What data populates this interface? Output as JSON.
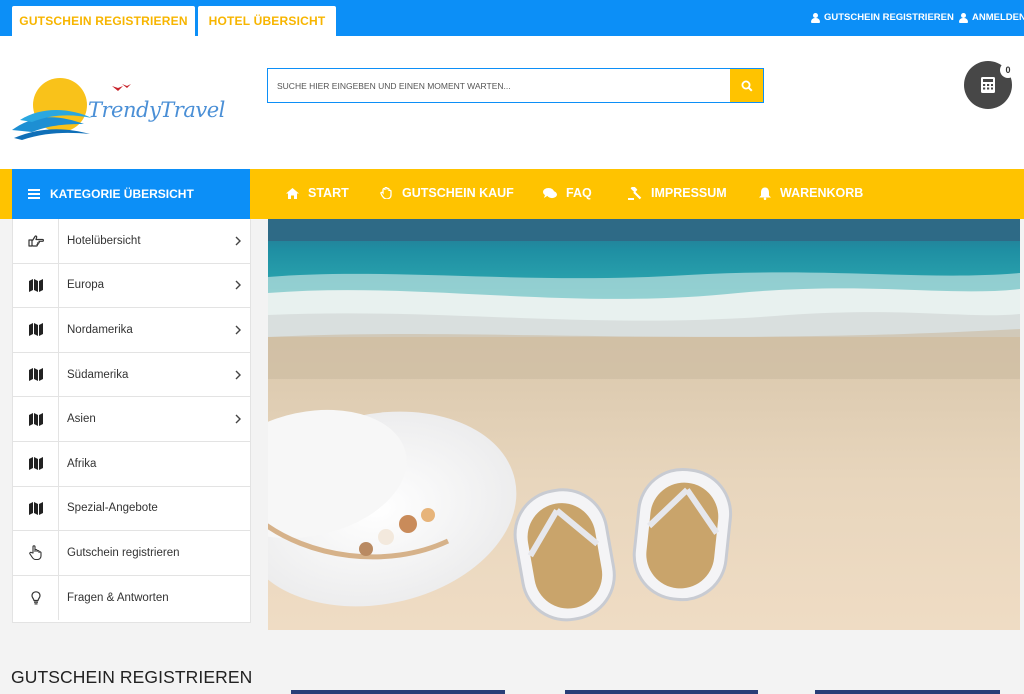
{
  "topbar": {
    "tabs": [
      "GUTSCHEIN REGISTRIEREN",
      "HOTEL ÜBERSICHT"
    ],
    "links": [
      "GUTSCHEIN REGISTRIEREN",
      "ANMELDEN"
    ]
  },
  "header": {
    "logo_text": "TrendyTravel",
    "search_placeholder": "SUCHE HIER EINGEBEN UND EINEN MOMENT WARTEN...",
    "cart_count": "0"
  },
  "nav": {
    "category_label": "KATEGORIE ÜBERSICHT",
    "items": [
      "START",
      "GUTSCHEIN KAUF",
      "FAQ",
      "IMPRESSUM",
      "WARENKORB"
    ]
  },
  "sidebar": {
    "items": [
      {
        "label": "Hotelübersicht",
        "icon": "hand-point-icon",
        "chevron": true
      },
      {
        "label": "Europa",
        "icon": "map-icon",
        "chevron": true
      },
      {
        "label": "Nordamerika",
        "icon": "map-icon",
        "chevron": true
      },
      {
        "label": "Südamerika",
        "icon": "map-icon",
        "chevron": true
      },
      {
        "label": "Asien",
        "icon": "map-icon",
        "chevron": true
      },
      {
        "label": "Afrika",
        "icon": "map-icon",
        "chevron": false
      },
      {
        "label": "Spezial-Angebote",
        "icon": "map-icon",
        "chevron": false
      },
      {
        "label": "Gutschein registrieren",
        "icon": "hand-pointer-icon",
        "chevron": false
      },
      {
        "label": "Fragen & Antworten",
        "icon": "lightbulb-icon",
        "chevron": false
      }
    ]
  },
  "main": {
    "section_title": "GUTSCHEIN REGISTRIEREN"
  },
  "colors": {
    "blue": "#0c8ff7",
    "yellow": "#ffc300",
    "dark": "#474747"
  }
}
